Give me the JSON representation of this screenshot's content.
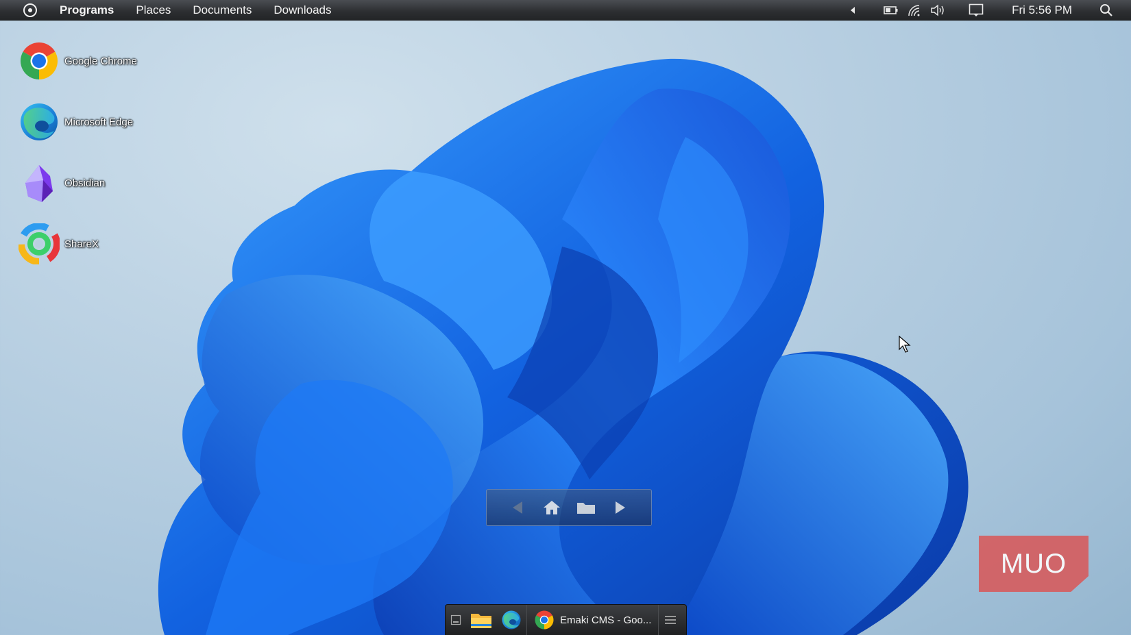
{
  "top_panel": {
    "menu": [
      "Programs",
      "Places",
      "Documents",
      "Downloads"
    ],
    "clock": "Fri 5:56 PM"
  },
  "desktop_icons": [
    {
      "label": "Google Chrome",
      "icon": "chrome-icon"
    },
    {
      "label": "Microsoft Edge",
      "icon": "edge-icon"
    },
    {
      "label": "Obsidian",
      "icon": "obsidian-icon"
    },
    {
      "label": "ShareX",
      "icon": "sharex-icon"
    }
  ],
  "taskbar": {
    "window_title": "Emaki CMS - Goo..."
  },
  "watermark": "MUO",
  "colors": {
    "panel": "#2c2e31",
    "wallpaper_bg": "#b9d0e2",
    "bloom": "#1a6fe8",
    "watermark": "#d8595a"
  }
}
